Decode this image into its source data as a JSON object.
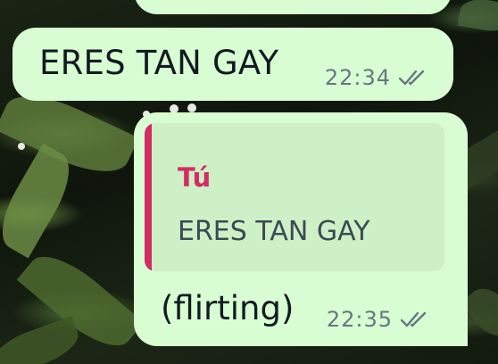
{
  "messages": [
    {
      "text": "ERES TAN GAY",
      "time": "22:34",
      "status_icon": "double-check-icon"
    },
    {
      "quote": {
        "author": "Tú",
        "text": "ERES TAN GAY"
      },
      "text": "(flirting)",
      "time": "22:35",
      "status_icon": "double-check-icon"
    }
  ],
  "colors": {
    "outgoing_bubble": "#d9fdd3",
    "quote_background": "#cdf0c6",
    "quote_accent": "#d42a66",
    "meta_text": "#667781"
  }
}
